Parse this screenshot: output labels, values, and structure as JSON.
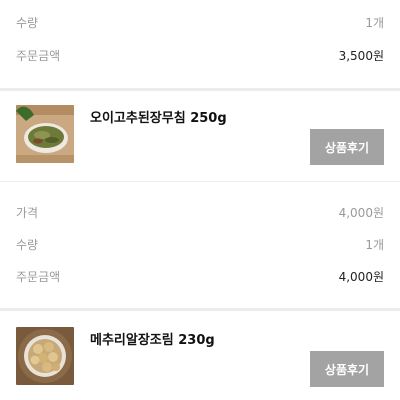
{
  "order_top": {
    "qty_label": "수량",
    "qty_value": "1개",
    "total_label": "주문금액",
    "total_value": "3,500원"
  },
  "product1": {
    "name": "오이고추된장무침 250g",
    "review_label": "상품후기",
    "thumbnail_icon": "cucumber-pepper-dish-image",
    "price_label": "가격",
    "price_value": "4,000원",
    "qty_label": "수량",
    "qty_value": "1개",
    "total_label": "주문금액",
    "total_value": "4,000원"
  },
  "product2": {
    "name": "메추리알장조림 230g",
    "review_label": "상품후기",
    "thumbnail_icon": "quail-egg-dish-image"
  },
  "colors": {
    "button_bg": "#a3a3a3",
    "muted_text": "#9a9a9a",
    "divider": "#ececec"
  }
}
